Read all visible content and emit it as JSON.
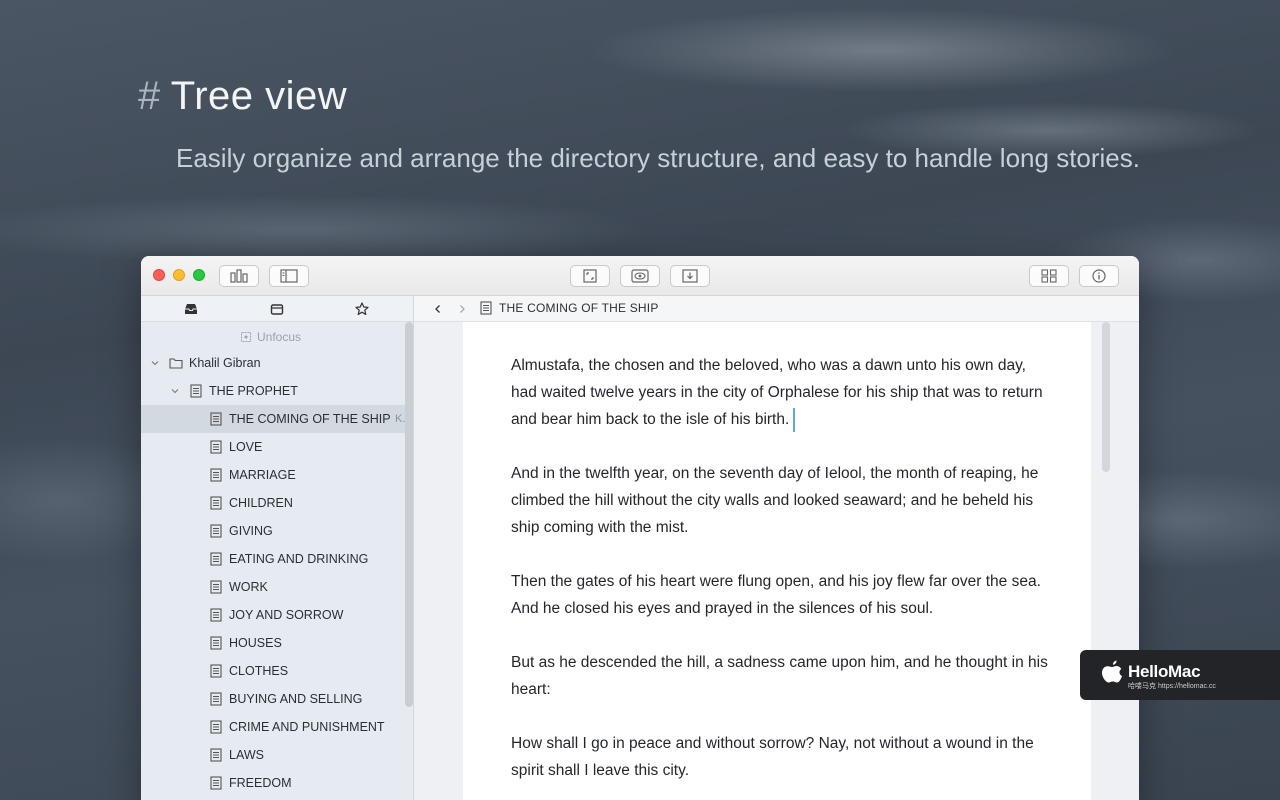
{
  "hero": {
    "hash": "#",
    "title": "Tree view",
    "subtitle": "Easily organize and arrange the directory structure, and easy to handle long stories."
  },
  "titlebar": {
    "buttons": [
      "library-icon",
      "sidebar-icon",
      "focus-icon",
      "preview-icon",
      "export-icon",
      "grid-icon",
      "info-icon"
    ]
  },
  "sidebar": {
    "tabs": [
      "inbox-icon",
      "archive-icon",
      "star-icon"
    ],
    "unfocus_label": "Unfocus",
    "author": "Khalil Gibran",
    "book": "THE PROPHET",
    "chapters": [
      "THE COMING OF THE SHIP",
      "LOVE",
      "MARRIAGE",
      "CHILDREN",
      "GIVING",
      "EATING AND DRINKING",
      "WORK",
      "JOY AND SORROW",
      "HOUSES",
      "CLOTHES",
      "BUYING AND SELLING",
      "CRIME AND PUNISHMENT",
      "LAWS",
      "FREEDOM"
    ],
    "selected_extra": "K."
  },
  "editor": {
    "doc_title": "THE COMING OF THE SHIP",
    "paragraphs": [
      "Almustafa, the chosen and the beloved, who was a dawn unto his own day, had waited twelve years in the city of Orphalese for his ship that was to return and bear him back to the isle of his birth.",
      "And in the twelfth year, on the seventh day of Ielool, the month of reaping, he climbed the hill without the city walls and looked seaward; and he beheld his ship coming with the mist.",
      "Then the gates of his heart were flung open, and his joy flew far over the sea. And he closed his eyes and prayed in the silences of his soul.",
      "But as he descended the hill, a sadness came upon him, and he thought in his heart:",
      "How shall I go in peace and without sorrow? Nay, not without a wound in the spirit shall I leave this city."
    ]
  },
  "watermark": {
    "name": "HelloMac",
    "url": "哈喽马克 https://hellomac.cc"
  }
}
